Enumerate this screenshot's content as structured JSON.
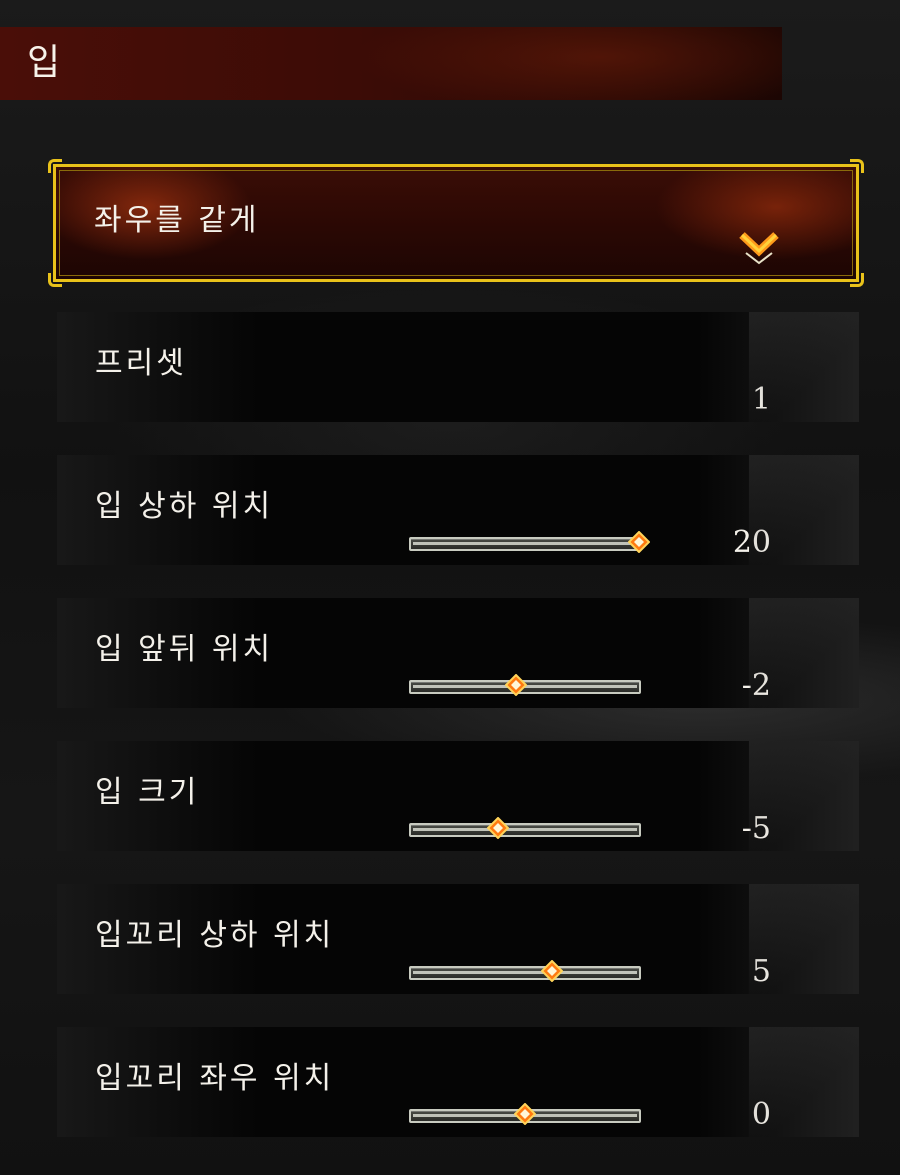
{
  "header": {
    "title": "입"
  },
  "dropdown": {
    "label": "좌우를 같게"
  },
  "preset": {
    "label": "프리셋",
    "value": "1"
  },
  "sliders": [
    {
      "label": "입 상하 위치",
      "value": "20",
      "fraction": 1.0
    },
    {
      "label": "입 앞뒤 위치",
      "value": "-2",
      "fraction": 0.46
    },
    {
      "label": "입 크기",
      "value": "-5",
      "fraction": 0.38
    },
    {
      "label": "입꼬리 상하 위치",
      "value": "5",
      "fraction": 0.62
    },
    {
      "label": "입꼬리 좌우 위치",
      "value": "0",
      "fraction": 0.5
    }
  ],
  "colors": {
    "accent_gold": "#e9c21a",
    "thumb_orange": "#ff8a1c",
    "header_red": "#4a0e08"
  },
  "icons": {
    "dropdown": "chevron-down-icon",
    "slider_thumb": "diamond-thumb-icon"
  }
}
